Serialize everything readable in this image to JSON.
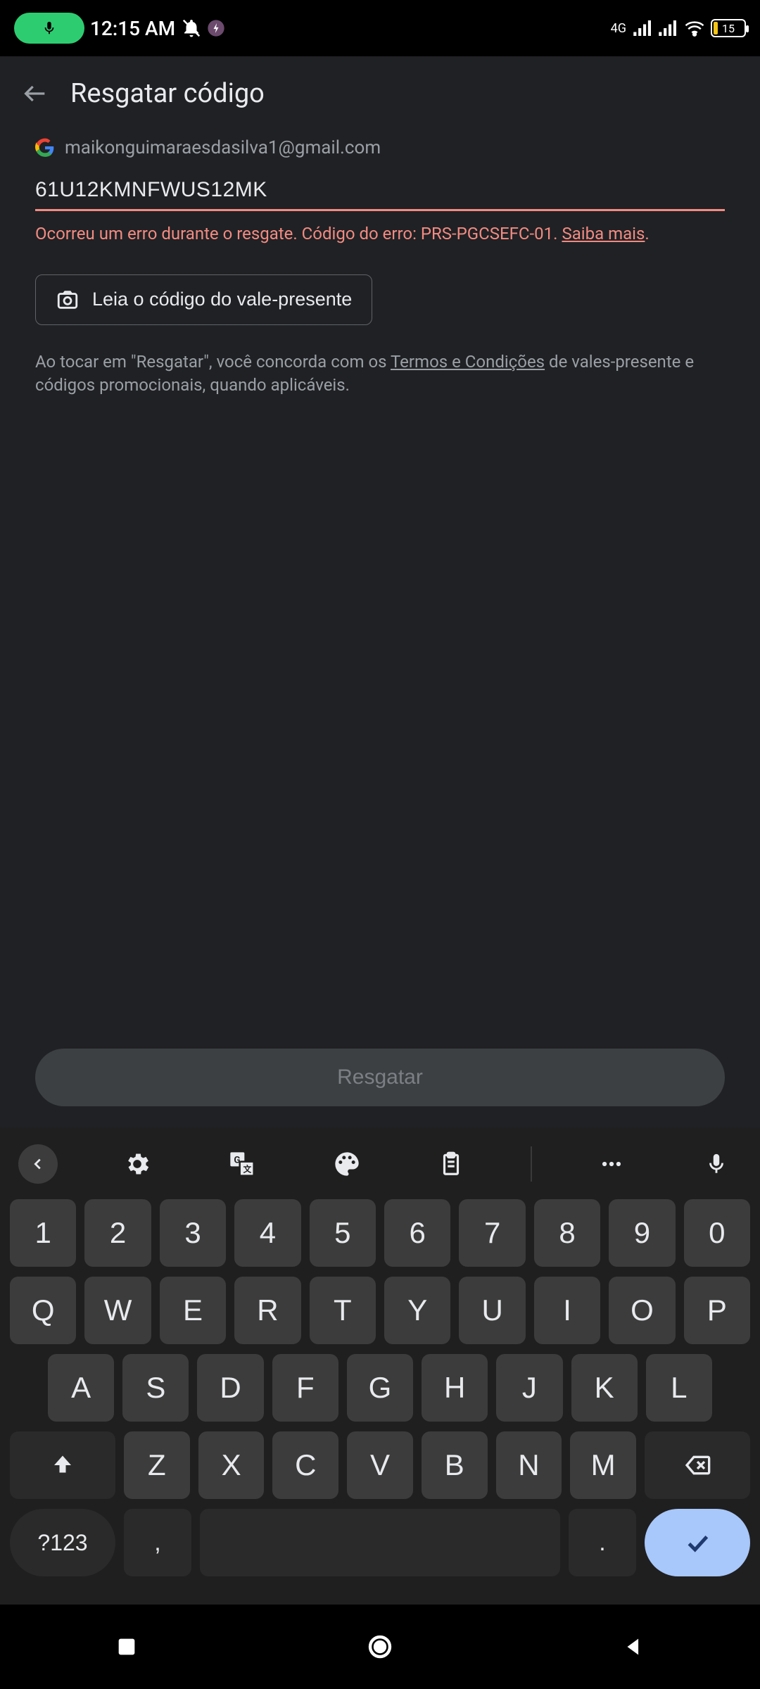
{
  "status": {
    "time": "12:15 AM",
    "network_label": "4G",
    "battery_percent": "15"
  },
  "appbar": {
    "title": "Resgatar código"
  },
  "account": {
    "email": "maikonguimaraesdasilva1@gmail.com"
  },
  "input": {
    "code_value": "61U12KMNFWUS12MK"
  },
  "error": {
    "text_prefix": "Ocorreu um erro durante o resgate. Código do erro: PRS-PGCSEFC-01. ",
    "link_text": "Saiba mais",
    "suffix": "."
  },
  "scan_button": {
    "label": "Leia o código do vale-presente"
  },
  "terms": {
    "prefix": "Ao tocar em \"Resgatar\", você concorda com os ",
    "link": "Termos e Condições",
    "suffix": " de vales-presente e códigos promocionais, quando aplicáveis."
  },
  "redeem": {
    "label": "Resgatar"
  },
  "keyboard": {
    "row_num": [
      "1",
      "2",
      "3",
      "4",
      "5",
      "6",
      "7",
      "8",
      "9",
      "0"
    ],
    "row1": [
      "Q",
      "W",
      "E",
      "R",
      "T",
      "Y",
      "U",
      "I",
      "O",
      "P"
    ],
    "row2": [
      "A",
      "S",
      "D",
      "F",
      "G",
      "H",
      "J",
      "K",
      "L"
    ],
    "row3": [
      "Z",
      "X",
      "C",
      "V",
      "B",
      "N",
      "M"
    ],
    "sym": "?123",
    "comma": ",",
    "period": "."
  }
}
